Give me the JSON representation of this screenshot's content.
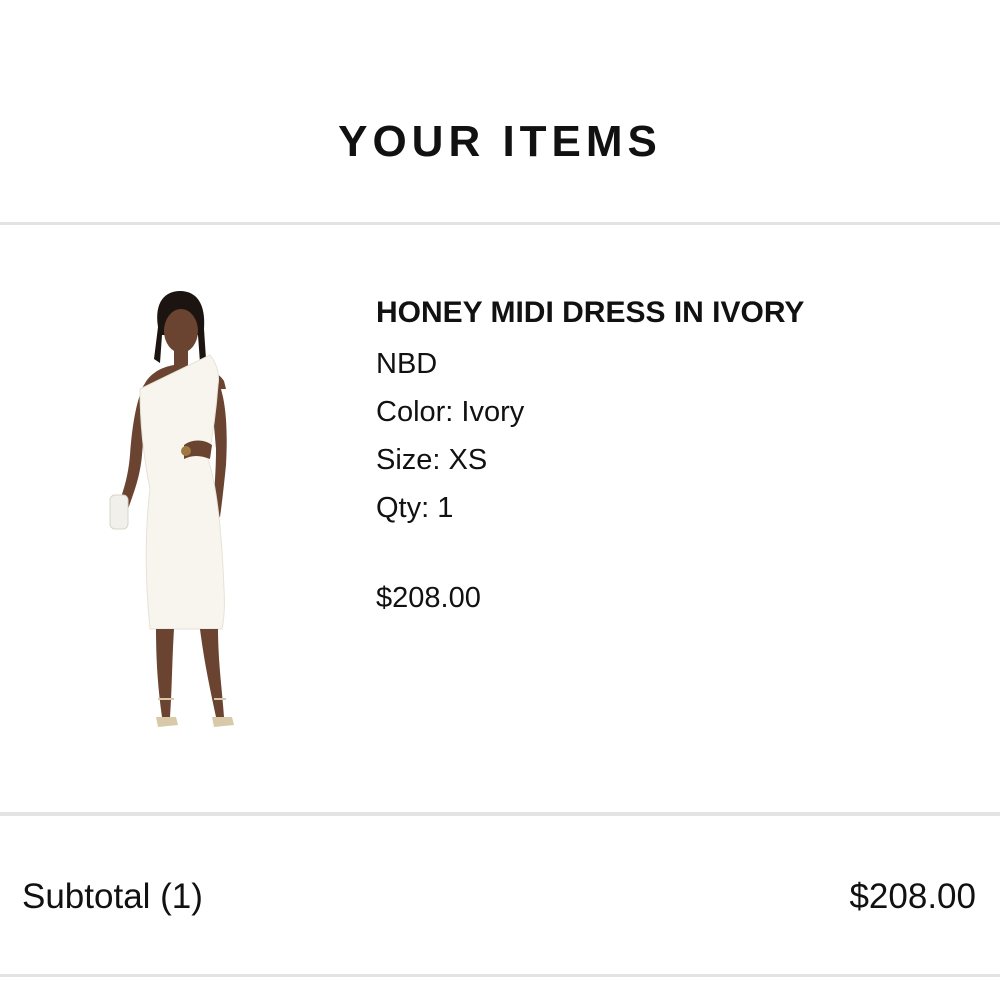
{
  "header": {
    "title": "YOUR ITEMS"
  },
  "item": {
    "name": "HONEY MIDI DRESS IN IVORY",
    "brand": "NBD",
    "color": "Color: Ivory",
    "size": "Size: XS",
    "qty": "Qty: 1",
    "price": "$208.00",
    "image_subject": "model-in-ivory-one-shoulder-midi-dress"
  },
  "summary": {
    "subtotal_label": "Subtotal (1)",
    "subtotal_value": "$208.00"
  },
  "colors": {
    "text": "#111111",
    "divider": "#e3e3e3",
    "background": "#ffffff",
    "dress": "#f7f5ee",
    "skin": "#6b4331"
  }
}
